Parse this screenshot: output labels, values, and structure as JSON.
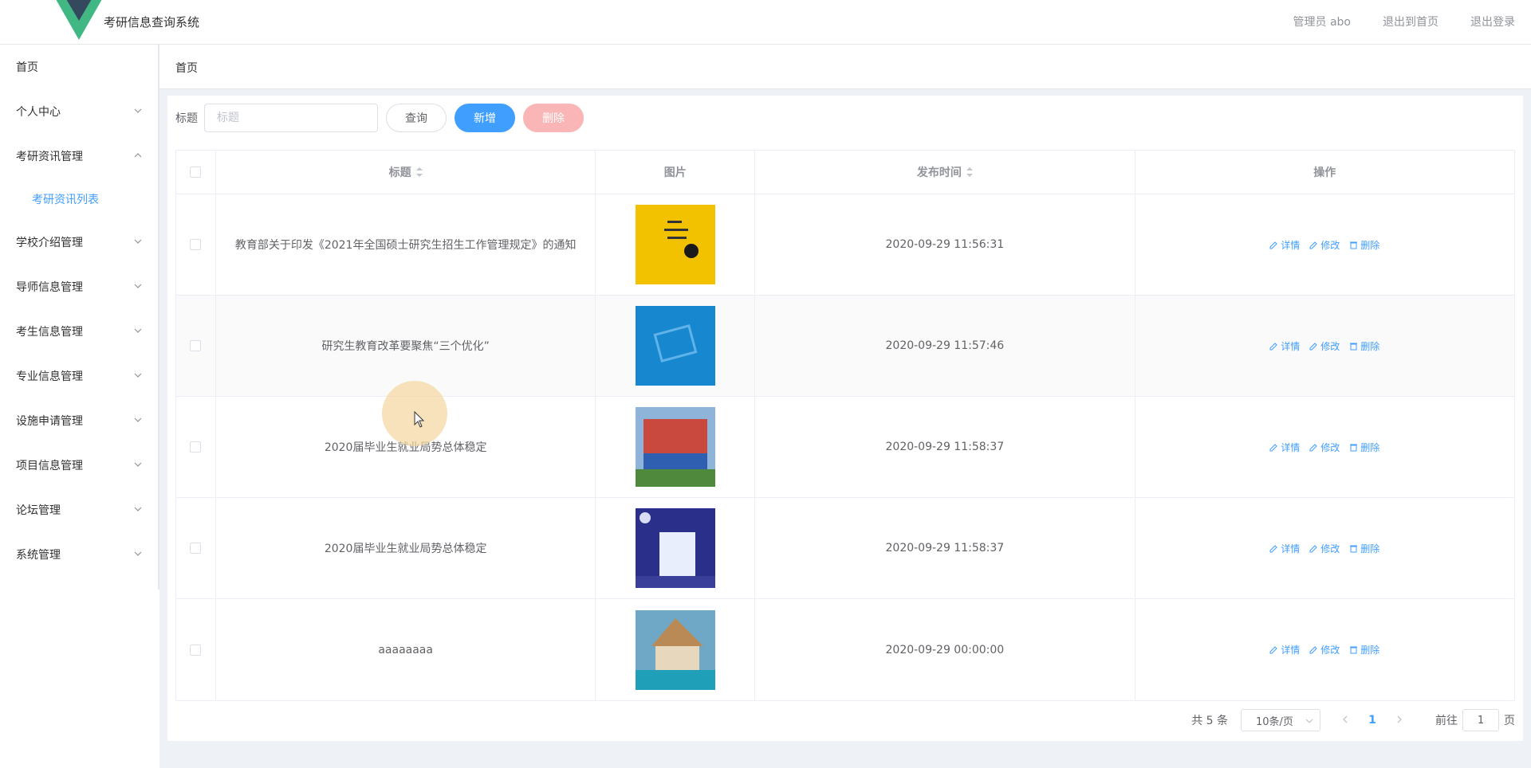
{
  "header": {
    "app_title": "考研信息查询系统",
    "admin_label": "管理员 abo",
    "back_home": "退出到首页",
    "logout": "退出登录"
  },
  "sidebar": {
    "items": [
      {
        "label": "首页"
      },
      {
        "label": "个人中心"
      },
      {
        "label": "考研资讯管理",
        "sub": "考研资讯列表"
      },
      {
        "label": "学校介绍管理"
      },
      {
        "label": "导师信息管理"
      },
      {
        "label": "考生信息管理"
      },
      {
        "label": "专业信息管理"
      },
      {
        "label": "设施申请管理"
      },
      {
        "label": "项目信息管理"
      },
      {
        "label": "论坛管理"
      },
      {
        "label": "系统管理"
      }
    ]
  },
  "breadcrumb": "首页",
  "search": {
    "label": "标题",
    "placeholder": "标题",
    "query_btn": "查询",
    "add_btn": "新增",
    "delete_btn": "删除"
  },
  "table": {
    "headers": {
      "title": "标题",
      "image": "图片",
      "time": "发布时间",
      "ops": "操作"
    },
    "ops": {
      "detail": "详情",
      "edit": "修改",
      "delete": "删除"
    },
    "rows": [
      {
        "title": "教育部关于印发《2021年全国硕士研究生招生工作管理规定》的通知",
        "time": "2020-09-29 11:56:31"
      },
      {
        "title": "研究生教育改革要聚焦“三个优化”",
        "time": "2020-09-29 11:57:46"
      },
      {
        "title": "2020届毕业生就业局势总体稳定",
        "time": "2020-09-29 11:58:37"
      },
      {
        "title": "2020届毕业生就业局势总体稳定",
        "time": "2020-09-29 11:58:37"
      },
      {
        "title": "aaaaaaaa",
        "time": "2020-09-29 00:00:00"
      }
    ]
  },
  "pagination": {
    "total": "共 5 条",
    "page_size": "10条/页",
    "current": "1",
    "goto_label": "前往",
    "goto_value": "1",
    "page_unit": "页"
  },
  "colors": {
    "primary": "#409eff",
    "danger_disabled": "#fab6b6",
    "logo_green": "#41b883",
    "logo_dark": "#35495e"
  }
}
